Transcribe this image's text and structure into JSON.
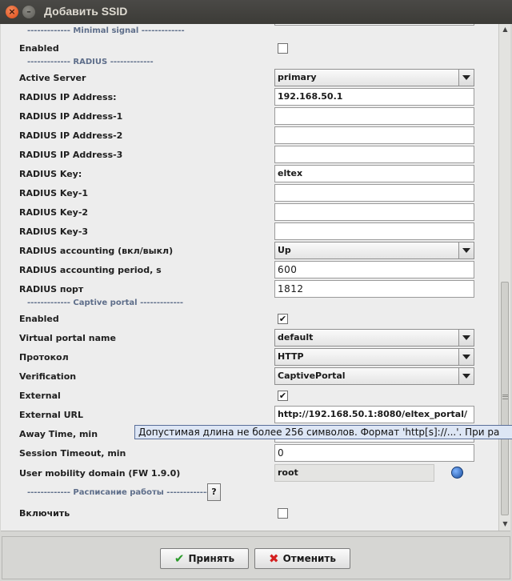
{
  "window": {
    "title": "Добавить SSID"
  },
  "form": {
    "sections": {
      "minimal_signal": "------------- Minimal signal -------------",
      "radius": "------------- RADIUS -------------",
      "captive_portal": "------------- Captive portal -------------",
      "schedule": "------------- Расписание работы ---------------"
    },
    "minimal_signal_enabled": {
      "label": "Enabled",
      "checked": false
    },
    "active_server": {
      "label": "Active Server",
      "value": "primary"
    },
    "radius_ip": {
      "label": "RADIUS IP Address:",
      "value": "192.168.50.1"
    },
    "radius_ip_1": {
      "label": "RADIUS IP Address-1",
      "value": ""
    },
    "radius_ip_2": {
      "label": "RADIUS IP Address-2",
      "value": ""
    },
    "radius_ip_3": {
      "label": "RADIUS IP Address-3",
      "value": ""
    },
    "radius_key": {
      "label": "RADIUS Key:",
      "value": "eltex"
    },
    "radius_key_1": {
      "label": "RADIUS Key-1",
      "value": ""
    },
    "radius_key_2": {
      "label": "RADIUS Key-2",
      "value": ""
    },
    "radius_key_3": {
      "label": "RADIUS Key-3",
      "value": ""
    },
    "radius_accounting": {
      "label": "RADIUS accounting (вкл/выкл)",
      "value": "Up"
    },
    "radius_accounting_period": {
      "label": "RADIUS accounting period, s",
      "value": "600"
    },
    "radius_port": {
      "label": "RADIUS порт",
      "value": "1812"
    },
    "captive_enabled": {
      "label": "Enabled",
      "checked": true
    },
    "virtual_portal_name": {
      "label": "Virtual portal name",
      "value": "default"
    },
    "protocol": {
      "label": "Протокол",
      "value": "HTTP"
    },
    "verification": {
      "label": "Verification",
      "value": "CaptivePortal"
    },
    "external": {
      "label": "External",
      "checked": true
    },
    "external_url": {
      "label": "External URL",
      "value": "http://192.168.50.1:8080/eltex_portal/"
    },
    "away_time": {
      "label": "Away Time, min",
      "value": ""
    },
    "session_timeout": {
      "label": "Session Timeout, min",
      "value": "0"
    },
    "user_mobility_domain": {
      "label": "User mobility domain (FW 1.9.0)",
      "value": "root"
    },
    "schedule_help": "?",
    "schedule_enable": {
      "label": "Включить",
      "checked": false
    },
    "tooltip": "Допустимая длина не более 256 символов. Формат 'http[s]://...'. При ра"
  },
  "buttons": {
    "accept": "Принять",
    "cancel": "Отменить"
  },
  "icons": {
    "close": "close-icon",
    "minimize": "minimize-icon",
    "globe": "globe-icon"
  }
}
